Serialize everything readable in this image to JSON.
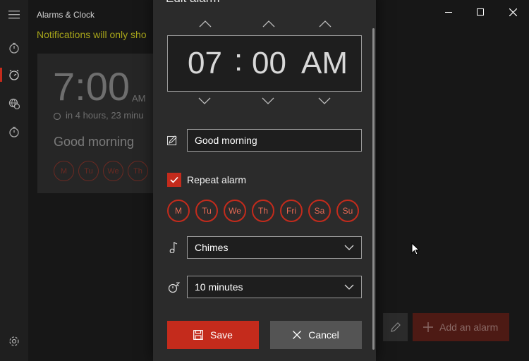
{
  "app": {
    "title": "Alarms & Clock"
  },
  "notice": "Notifications will only sho",
  "background_alarm": {
    "time": "7:00",
    "ampm": "AM",
    "next": "in 4 hours, 23 minu",
    "name": "Good morning",
    "days": [
      "M",
      "Tu",
      "We",
      "Th"
    ]
  },
  "bottom": {
    "add_label": "Add an alarm"
  },
  "dialog": {
    "title": "Edit alarm",
    "hour": "07",
    "separator": ":",
    "minute": "00",
    "ampm": "AM",
    "name_value": "Good morning",
    "repeat_label": "Repeat alarm",
    "repeat_checked": true,
    "days": [
      "M",
      "Tu",
      "We",
      "Th",
      "Fri",
      "Sa",
      "Su"
    ],
    "sound": "Chimes",
    "snooze": "10 minutes",
    "save_label": "Save",
    "cancel_label": "Cancel"
  },
  "colors": {
    "accent": "#c42b1c",
    "notice": "#a6a41a",
    "background": "#171717",
    "dialog": "#2b2b2b"
  }
}
